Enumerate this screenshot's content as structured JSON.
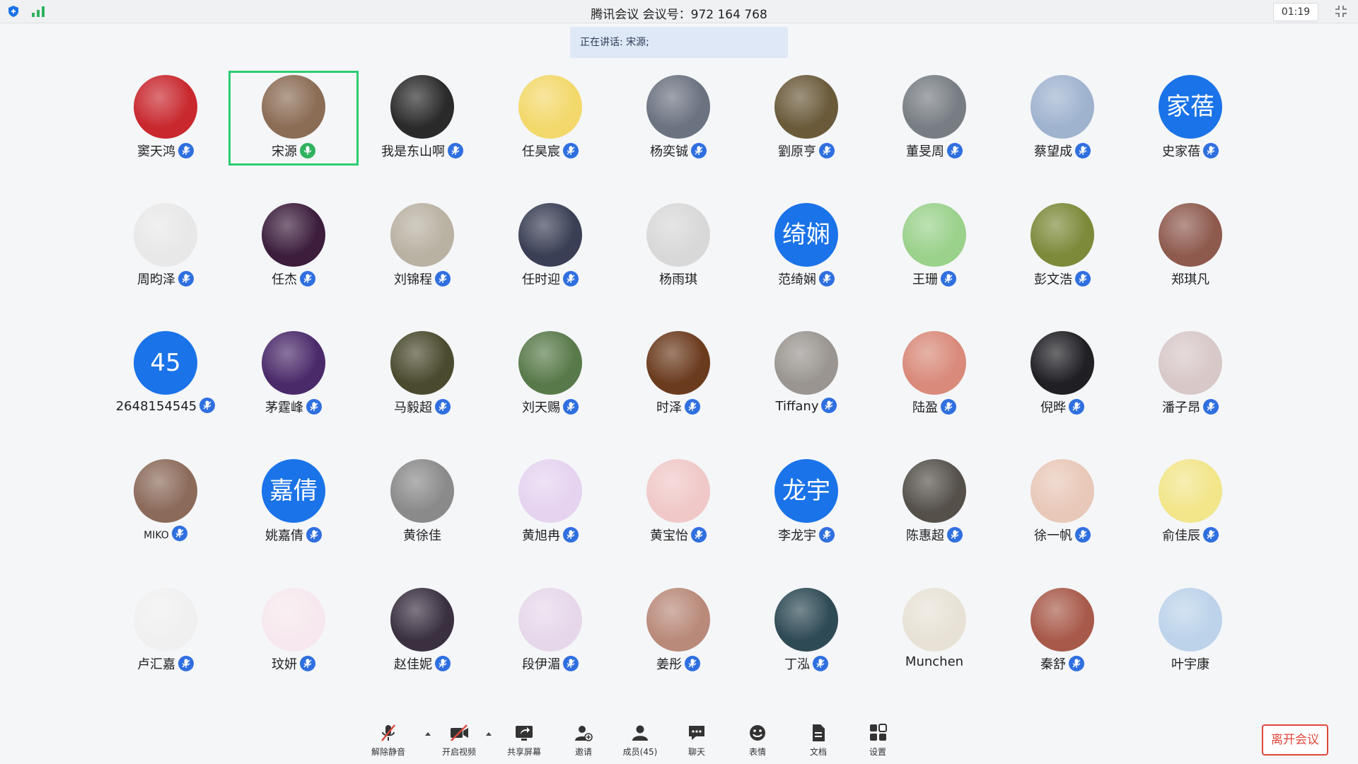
{
  "window": {
    "title": "腾讯会议 会议号：972 164 768",
    "timer": "01:19"
  },
  "speaking_banner": "正在讲话: 宋源;",
  "participants": [
    {
      "name": "窦天鸿",
      "avatar": "photo",
      "mic": "muted",
      "bg": "#c8282e"
    },
    {
      "name": "宋源",
      "avatar": "photo",
      "mic": "on",
      "bg": "#8b6c55",
      "active": true
    },
    {
      "name": "我是东山啊",
      "avatar": "photo",
      "mic": "muted",
      "bg": "#2a2a2a"
    },
    {
      "name": "任昊宸",
      "avatar": "photo",
      "mic": "muted",
      "bg": "#f3d86b"
    },
    {
      "name": "杨奕铖",
      "avatar": "photo",
      "mic": "muted",
      "bg": "#6b7280"
    },
    {
      "name": "劉原亨",
      "avatar": "photo",
      "mic": "muted",
      "bg": "#6a5a3a"
    },
    {
      "name": "董旻周",
      "avatar": "photo",
      "mic": "muted",
      "bg": "#777d83"
    },
    {
      "name": "蔡望成",
      "avatar": "photo",
      "mic": "muted",
      "bg": "#9fb3cf"
    },
    {
      "name": "史家蓓",
      "avatar": "text",
      "avatar_text": "家蓓",
      "mic": "muted",
      "bg": "#1a73e8"
    },
    {
      "name": "周昀泽",
      "avatar": "photo",
      "mic": "muted",
      "bg": "#e8e8e8"
    },
    {
      "name": "任杰",
      "avatar": "photo",
      "mic": "muted",
      "bg": "#3c1d3c"
    },
    {
      "name": "刘锦程",
      "avatar": "photo",
      "mic": "muted",
      "bg": "#b9b1a2"
    },
    {
      "name": "任时迎",
      "avatar": "photo",
      "mic": "muted",
      "bg": "#3a3f55"
    },
    {
      "name": "杨雨琪",
      "avatar": "photo",
      "mic": "none",
      "bg": "#d8d8d8"
    },
    {
      "name": "范绮娴",
      "avatar": "text",
      "avatar_text": "绮娴",
      "mic": "muted",
      "bg": "#1a73e8"
    },
    {
      "name": "王珊",
      "avatar": "photo",
      "mic": "muted",
      "bg": "#9ad18b"
    },
    {
      "name": "彭文浩",
      "avatar": "photo",
      "mic": "muted",
      "bg": "#7c8a3a"
    },
    {
      "name": "郑琪凡",
      "avatar": "photo",
      "mic": "none",
      "bg": "#8e5a4e"
    },
    {
      "name": "2648154545",
      "avatar": "text",
      "avatar_text": "45",
      "mic": "muted",
      "bg": "#1a73e8"
    },
    {
      "name": "茅霆峰",
      "avatar": "photo",
      "mic": "muted",
      "bg": "#4b2a6a"
    },
    {
      "name": "马毅超",
      "avatar": "photo",
      "mic": "muted",
      "bg": "#4a4a2e"
    },
    {
      "name": "刘天赐",
      "avatar": "photo",
      "mic": "muted",
      "bg": "#587a4a"
    },
    {
      "name": "时泽",
      "avatar": "photo",
      "mic": "muted",
      "bg": "#6b3b1e"
    },
    {
      "name": "Tiffany",
      "avatar": "photo",
      "mic": "muted",
      "bg": "#9a9590"
    },
    {
      "name": "陆盈",
      "avatar": "photo",
      "mic": "muted",
      "bg": "#d98a7a"
    },
    {
      "name": "倪晔",
      "avatar": "photo",
      "mic": "muted",
      "bg": "#1f1f24"
    },
    {
      "name": "潘子昂",
      "avatar": "photo",
      "mic": "muted",
      "bg": "#d8c8c8"
    },
    {
      "name": "MIKO",
      "avatar": "photo",
      "mic": "muted",
      "bg": "#8b6a5a",
      "small": true
    },
    {
      "name": "姚嘉倩",
      "avatar": "text",
      "avatar_text": "嘉倩",
      "mic": "muted",
      "bg": "#1a73e8"
    },
    {
      "name": "黄徐佳",
      "avatar": "photo",
      "mic": "none",
      "bg": "#8a8a8a"
    },
    {
      "name": "黄旭冉",
      "avatar": "photo",
      "mic": "muted",
      "bg": "#e5d3f0"
    },
    {
      "name": "黄宝怡",
      "avatar": "photo",
      "mic": "muted",
      "bg": "#f0c8c8"
    },
    {
      "name": "李龙宇",
      "avatar": "text",
      "avatar_text": "龙宇",
      "mic": "muted",
      "bg": "#1a73e8"
    },
    {
      "name": "陈惠超",
      "avatar": "photo",
      "mic": "muted",
      "bg": "#55504a"
    },
    {
      "name": "徐一帆",
      "avatar": "photo",
      "mic": "muted",
      "bg": "#e8c8b8"
    },
    {
      "name": "俞佳辰",
      "avatar": "photo",
      "mic": "muted",
      "bg": "#f2e58a"
    },
    {
      "name": "卢汇嘉",
      "avatar": "photo",
      "mic": "muted",
      "bg": "#f0f0f0"
    },
    {
      "name": "玟妍",
      "avatar": "photo",
      "mic": "muted",
      "bg": "#f6e8ee"
    },
    {
      "name": "赵佳妮",
      "avatar": "photo",
      "mic": "muted",
      "bg": "#3a3040"
    },
    {
      "name": "段伊湄",
      "avatar": "photo",
      "mic": "muted",
      "bg": "#e6d8ea"
    },
    {
      "name": "姜彤",
      "avatar": "photo",
      "mic": "muted",
      "bg": "#b98a7a"
    },
    {
      "name": "丁泓",
      "avatar": "photo",
      "mic": "muted",
      "bg": "#2e4a55"
    },
    {
      "name": "Munchen",
      "avatar": "photo",
      "mic": "none",
      "bg": "#e8e2d6"
    },
    {
      "name": "秦舒",
      "avatar": "photo",
      "mic": "muted",
      "bg": "#a85a4a"
    },
    {
      "name": "叶宇康",
      "avatar": "photo",
      "mic": "none",
      "bg": "#bcd3ea"
    }
  ],
  "toolbar": {
    "unmute": "解除静音",
    "video": "开启视频",
    "share": "共享屏幕",
    "invite": "邀请",
    "members": "成员(45)",
    "chat": "聊天",
    "emoji": "表情",
    "docs": "文档",
    "settings": "设置",
    "leave": "离开会议"
  },
  "colors": {
    "accent": "#1a73e8",
    "active_border": "#2ecc71",
    "leave": "#e0473a"
  }
}
